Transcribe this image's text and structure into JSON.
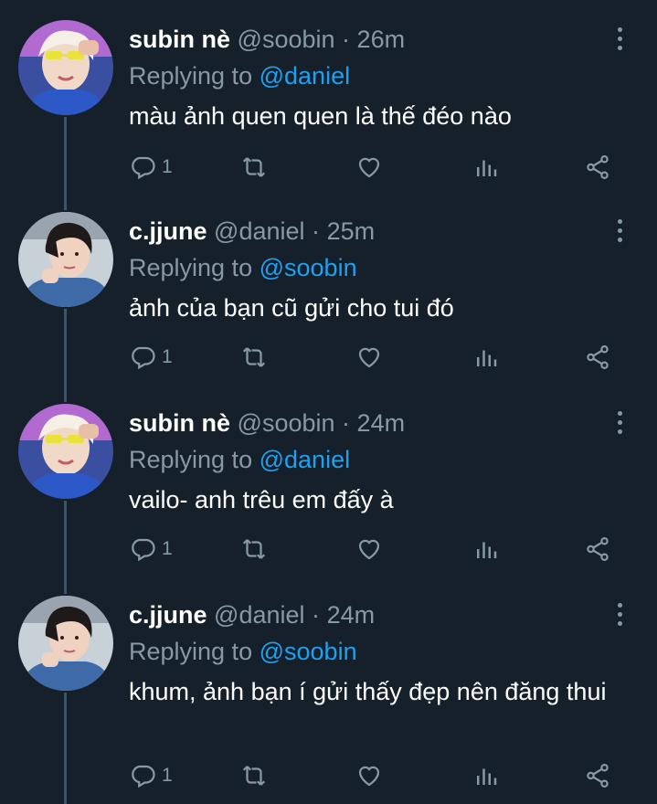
{
  "colors": {
    "background": "#15202b",
    "muted": "#8899a6",
    "accent": "#1da1f2",
    "thread_line": "#3d5466"
  },
  "replying_prefix": "Replying to",
  "tweets": [
    {
      "name": "subin nè",
      "handle": "@soobin",
      "separator": "·",
      "time": "26m",
      "reply_to": "@daniel",
      "text": "màu ảnh quen quen là thế đéo nào",
      "reply_count": "1",
      "avatar": "avatar-soobin"
    },
    {
      "name": "c.jjune",
      "handle": "@daniel",
      "separator": "·",
      "time": "25m",
      "reply_to": "@soobin",
      "text": "ảnh của bạn cũ gửi cho tui đó",
      "reply_count": "1",
      "avatar": "avatar-daniel"
    },
    {
      "name": "subin nè",
      "handle": "@soobin",
      "separator": "·",
      "time": "24m",
      "reply_to": "@daniel",
      "text": "vailo- anh trêu em đấy à",
      "reply_count": "1",
      "avatar": "avatar-soobin"
    },
    {
      "name": "c.jjune",
      "handle": "@daniel",
      "separator": "·",
      "time": "24m",
      "reply_to": "@soobin",
      "text": "khum, ảnh bạn í gửi thấy đẹp nên đăng thui",
      "reply_count": "1",
      "avatar": "avatar-daniel"
    }
  ],
  "icons": [
    "reply-icon",
    "retweet-icon",
    "like-icon",
    "analytics-icon",
    "share-icon",
    "more-icon"
  ]
}
